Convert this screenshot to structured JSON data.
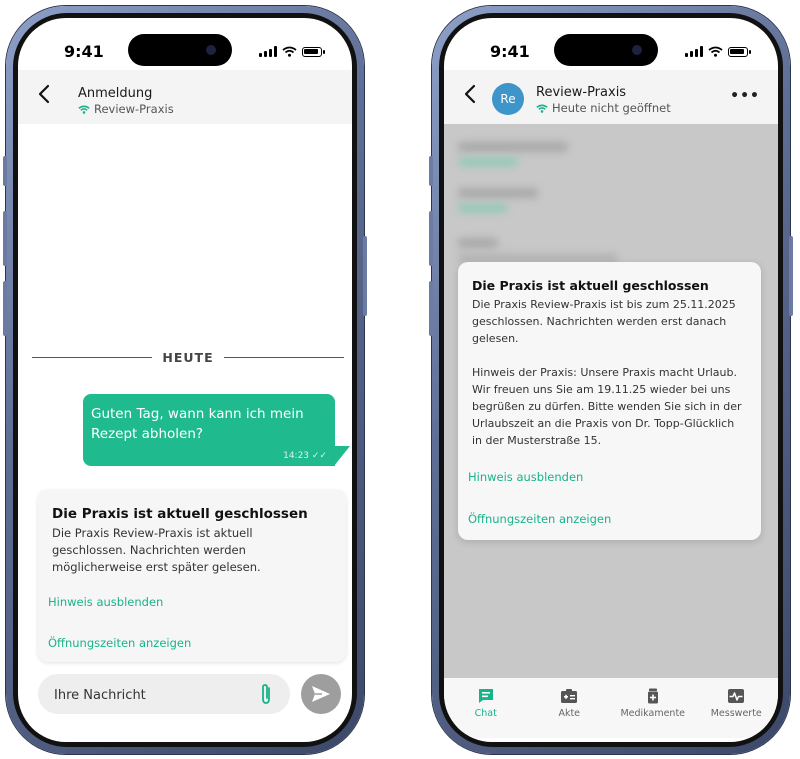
{
  "status_bar": {
    "time": "9:41"
  },
  "phone1": {
    "header": {
      "title": "Anmeldung",
      "subtitle": "Review-Praxis"
    },
    "date_divider": "HEUTE",
    "message": {
      "text": "Guten Tag, wann kann ich mein Rezept abholen?",
      "time": "14:23"
    },
    "notice": {
      "title": "Die Praxis ist aktuell geschlossen",
      "body": "Die Praxis Review-Praxis ist aktuell geschlossen. Nachrichten werden möglicherweise erst später gelesen.",
      "hide_link": "Hinweis ausblenden",
      "hours_link": "Öffnungszeiten anzeigen"
    },
    "composer": {
      "placeholder": "Ihre Nachricht"
    }
  },
  "phone2": {
    "header": {
      "avatar": "Re",
      "title": "Review-Praxis",
      "subtitle": "Heute nicht geöffnet"
    },
    "notice": {
      "title": "Die Praxis ist aktuell geschlossen",
      "body": "Die Praxis Review-Praxis ist bis zum 25.11.2025 geschlossen. Nachrichten werden erst danach gelesen.",
      "note": "Hinweis der Praxis: Unsere Praxis macht Urlaub. Wir freuen uns Sie am 19.11.25 wieder bei uns begrüßen zu dürfen. Bitte wenden Sie sich in der Urlaubszeit an die Praxis von Dr. Topp-Glücklich in der Musterstraße 15.",
      "hide_link": "Hinweis ausblenden",
      "hours_link": "Öffnungszeiten anzeigen"
    },
    "tabs": [
      {
        "label": "Chat"
      },
      {
        "label": "Akte"
      },
      {
        "label": "Medikamente"
      },
      {
        "label": "Messwerte"
      }
    ]
  },
  "colors": {
    "accent": "#1fbb8e",
    "avatar": "#3e95c9",
    "frame": "#5f6e94"
  }
}
